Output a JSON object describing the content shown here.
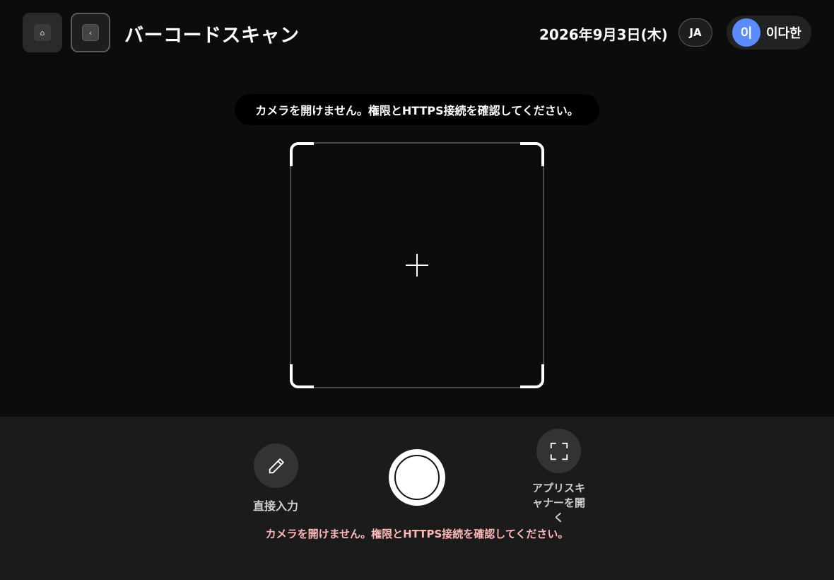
{
  "header": {
    "home_icon": "home-icon",
    "back_icon": "chevron-left-icon",
    "back_glyph": "‹",
    "home_glyph": "⌂",
    "title": "バーコードスキャン",
    "date": "2026年9月3日(木)",
    "language": "JA",
    "user": {
      "avatar_initial": "이",
      "name": "이다한",
      "avatar_color": "#5b8cff"
    }
  },
  "toast": {
    "message": "カメラを開けません。権限とHTTPS接続を確認してください。"
  },
  "scanner": {
    "center_icon": "crosshair-icon"
  },
  "controls": {
    "manual_entry": {
      "label": "直接入力",
      "icon": "pencil-icon"
    },
    "shutter": {
      "icon": "shutter-button"
    },
    "app_scanner": {
      "label": "アプリスキャナーを開く",
      "icon": "scan-frame-icon"
    },
    "error": "カメラを開けません。権限とHTTPS接続を確認してください。",
    "error_color": "#ffb8b8"
  }
}
